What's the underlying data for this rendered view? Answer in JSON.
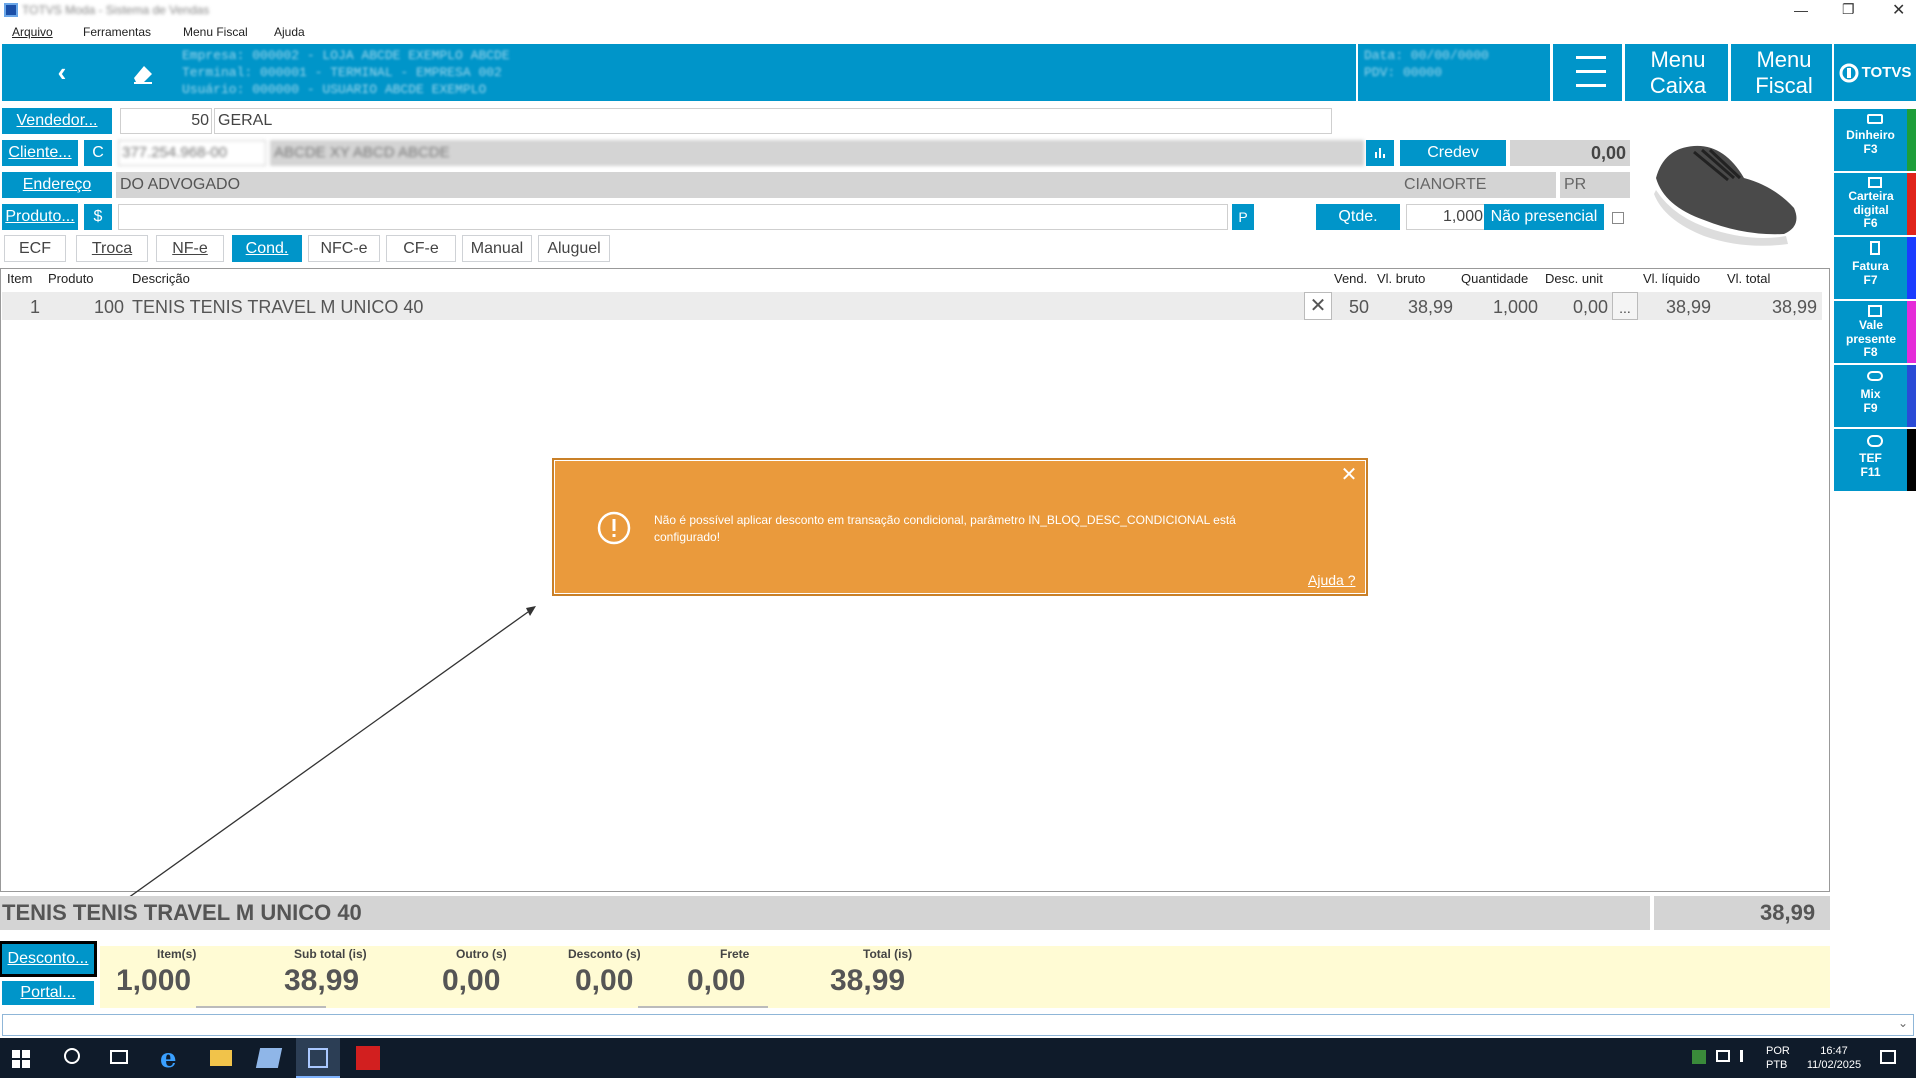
{
  "window": {
    "title": "TOTVS Moda - Sistema de Vendas"
  },
  "menu": {
    "arquivo": "Arquivo",
    "ferramentas": "Ferramentas",
    "menu_fiscal": "Menu Fiscal",
    "ajuda": "Ajuda"
  },
  "header": {
    "info_line1": "Empresa: 000002 - LOJA ABCDE EXEMPLO ABCDE",
    "info_line2": "Terminal: 000001 - TERMINAL - EMPRESA 002",
    "info_line3": "Usuário: 000000 - USUARIO ABCDE EXEMPLO",
    "date_line1": "Data: 00/00/0000",
    "date_line2": "PDV: 00000",
    "menu_caixa_1": "Menu",
    "menu_caixa_2": "Caixa",
    "menu_fiscal_1": "Menu",
    "menu_fiscal_2": "Fiscal",
    "logo": "TOTVS"
  },
  "form": {
    "vendedor_label": "Vendedor...",
    "vendedor_code": "50",
    "vendedor_name": "GERAL",
    "cliente_label": "Cliente...",
    "cliente_type": "C",
    "cliente_doc": "377.254.968-00",
    "cliente_name": "ABCDE XY ABCD ABCDE",
    "credev_label": "Credev",
    "credev_value": "0,00",
    "endereco_label": "Endereço",
    "endereco_value": "DO ADVOGADO",
    "cidade": "CIANORTE",
    "uf": "PR",
    "produto_label": "Produto...",
    "produto_currency": "$",
    "produto_value": "",
    "p_label": "P",
    "qtde_label": "Qtde.",
    "qtde_value": "1,000",
    "nao_presencial_label": "Não presencial"
  },
  "tabs": [
    {
      "label": "ECF"
    },
    {
      "label": "Troca"
    },
    {
      "label": "NF-e"
    },
    {
      "label": "Cond."
    },
    {
      "label": "NFC-e"
    },
    {
      "label": "CF-e"
    },
    {
      "label": "Manual"
    },
    {
      "label": "Aluguel"
    }
  ],
  "grid": {
    "headers": {
      "item": "Item",
      "produto": "Produto",
      "descricao": "Descrição",
      "vend": "Vend.",
      "vl_bruto": "Vl. bruto",
      "quantidade": "Quantidade",
      "desc_unit": "Desc. unit",
      "vl_liquido": "Vl. líquido",
      "vl_total": "Vl. total"
    },
    "rows": [
      {
        "item": "1",
        "produto": "100",
        "descricao": "TENIS TENIS TRAVEL M UNICO 40",
        "vend": "50",
        "vl_bruto": "38,99",
        "quantidade": "1,000",
        "desc_unit": "0,00",
        "more": "...",
        "vl_liquido": "38,99",
        "vl_total": "38,99"
      }
    ]
  },
  "alert": {
    "message": "Não é possível aplicar desconto em transação condicional, parâmetro IN_BLOQ_DESC_CONDICIONAL está configurado!",
    "help_link": "Ajuda ?",
    "color": "#ea9a3c"
  },
  "summary": {
    "product_name": "TENIS TENIS TRAVEL M UNICO 40",
    "product_value": "38,99"
  },
  "footer": {
    "desconto_label": "Desconto...",
    "portal_label": "Portal...",
    "itens_label": "Item(s)",
    "itens_value": "1,000",
    "subtotal_label": "Sub total (is)",
    "subtotal_value": "38,99",
    "outro_label": "Outro (s)",
    "outro_value": "0,00",
    "desconto_s_label": "Desconto (s)",
    "desconto_s_value": "0,00",
    "frete_label": "Frete",
    "frete_value": "0,00",
    "total_label": "Total (is)",
    "total_value": "38,99"
  },
  "sidebar": [
    {
      "label": "Dinheiro",
      "key": "F3",
      "color": "#1e9e3a",
      "icon": "money-icon"
    },
    {
      "label": "Carteira digital",
      "key": "F6",
      "color": "#e0241b",
      "icon": "wallet-icon"
    },
    {
      "label": "Fatura",
      "key": "F7",
      "color": "#1a3cff",
      "icon": "invoice-icon"
    },
    {
      "label": "Vale presente",
      "key": "F8",
      "color": "#e52bd8",
      "icon": "gift-icon"
    },
    {
      "label": "Mix",
      "key": "F9",
      "color": "#2a4bd6",
      "icon": "mix-icon"
    },
    {
      "label": "TEF",
      "key": "F11",
      "color": "#000000",
      "icon": "chat-icon"
    }
  ],
  "taskbar": {
    "lang1": "POR",
    "lang2": "PTB",
    "time": "16:47",
    "date": "11/02/2025"
  }
}
